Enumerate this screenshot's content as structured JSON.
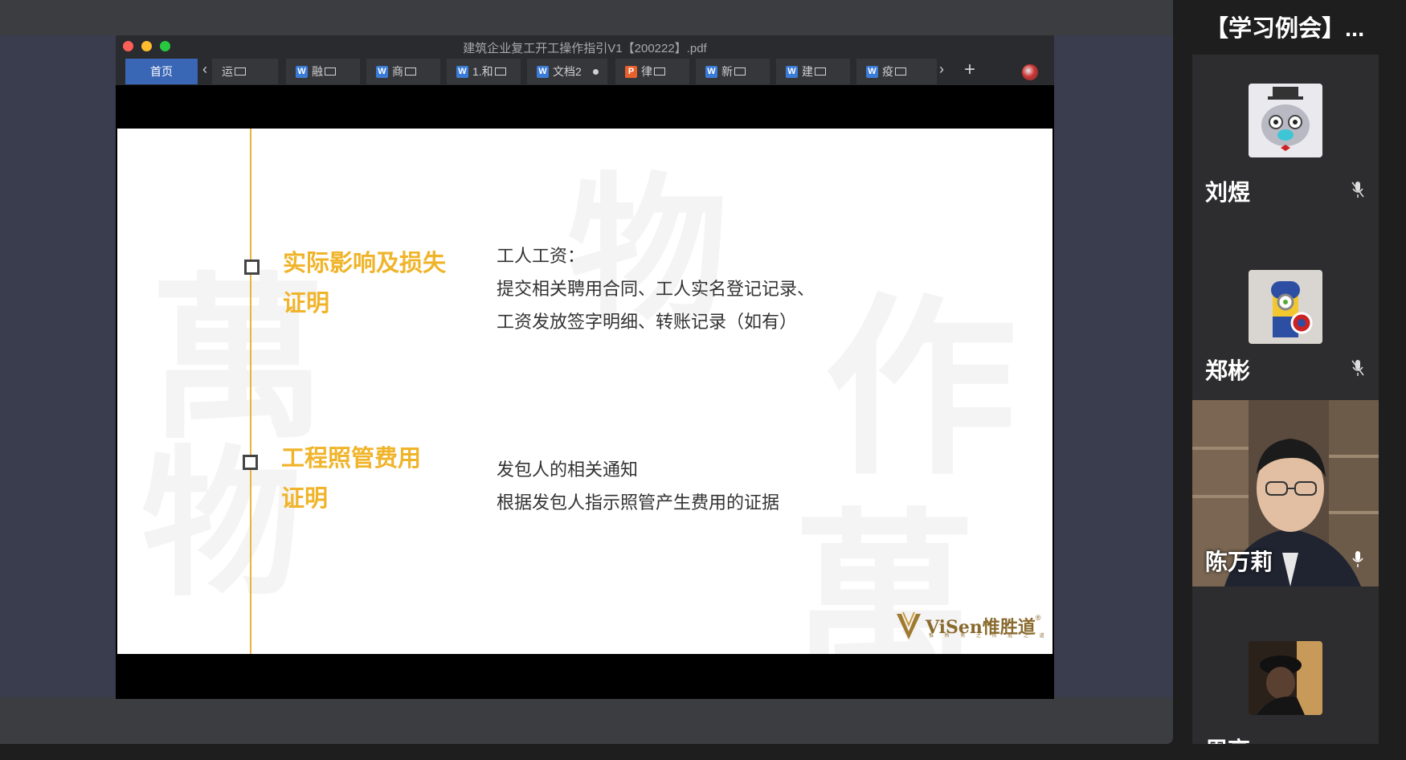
{
  "window": {
    "title": "建筑企业复工开工操作指引V1【200222】.pdf"
  },
  "tabs": [
    {
      "label": "首页",
      "type": "home"
    },
    {
      "label": "运",
      "type": "monitor"
    },
    {
      "label": "融",
      "type": "word"
    },
    {
      "label": "商",
      "type": "word"
    },
    {
      "label": "1.和",
      "type": "word"
    },
    {
      "label": "文档2",
      "type": "word-dot"
    },
    {
      "label": "律",
      "type": "ppt"
    },
    {
      "label": "新",
      "type": "word"
    },
    {
      "label": "建",
      "type": "word"
    },
    {
      "label": "疫",
      "type": "word"
    }
  ],
  "tab_nav": {
    "left": "‹",
    "right": "›",
    "add": "+"
  },
  "slide": {
    "watermark_chars": [
      "萬",
      "物",
      "作",
      "物",
      "萬"
    ],
    "items": [
      {
        "heading_line1": "实际影响及损失",
        "heading_line2": "证明",
        "body": [
          "工人工资：",
          "提交相关聘用合同、工人实名登记记录、",
          "工资发放签字明细、转账记录（如有）"
        ]
      },
      {
        "heading_line1": "工程照管费用",
        "heading_line2": "证明",
        "body": [
          "发包人的相关通知",
          "根据发包人指示照管产生费用的证据"
        ]
      }
    ],
    "logo": {
      "text": "ViSen惟胜道",
      "registered": "®",
      "subtitle": "惟 所 有 之 所 胜 之 道"
    }
  },
  "panel": {
    "meeting_title": "【学习例会】...",
    "participants": [
      {
        "name": "刘煜",
        "muted": true,
        "avatar": "cat-avatar"
      },
      {
        "name": "郑彬",
        "muted": true,
        "avatar": "minion-avatar"
      },
      {
        "name": "陈万莉",
        "muted": false,
        "avatar": "video"
      },
      {
        "name": "周高",
        "muted": true,
        "avatar": "photo-avatar"
      }
    ]
  },
  "colors": {
    "accent_gold": "#f0b42a",
    "home_tab": "#3a66b6",
    "panel_bg": "#1e1e1f"
  }
}
